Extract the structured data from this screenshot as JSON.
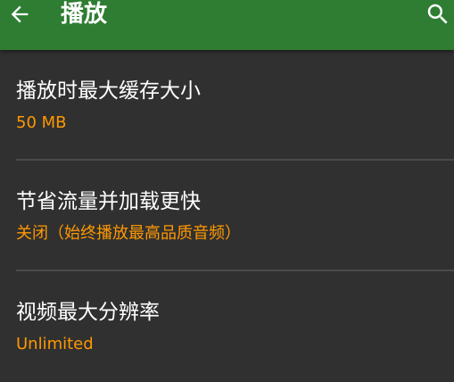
{
  "appbar": {
    "title": "播放",
    "back_icon": "arrow-left-icon",
    "search_icon": "search-icon",
    "color": "#2e7d32"
  },
  "preferences": [
    {
      "title": "播放时最大缓存大小",
      "summary": "50 MB"
    },
    {
      "title": "节省流量并加载更快",
      "summary": "关闭（始终播放最高品质音频）"
    },
    {
      "title": "视频最大分辨率",
      "summary": "Unlimited"
    }
  ],
  "colors": {
    "background": "#303030",
    "summary_accent": "#ff9800",
    "divider": "#4a4a4a"
  }
}
